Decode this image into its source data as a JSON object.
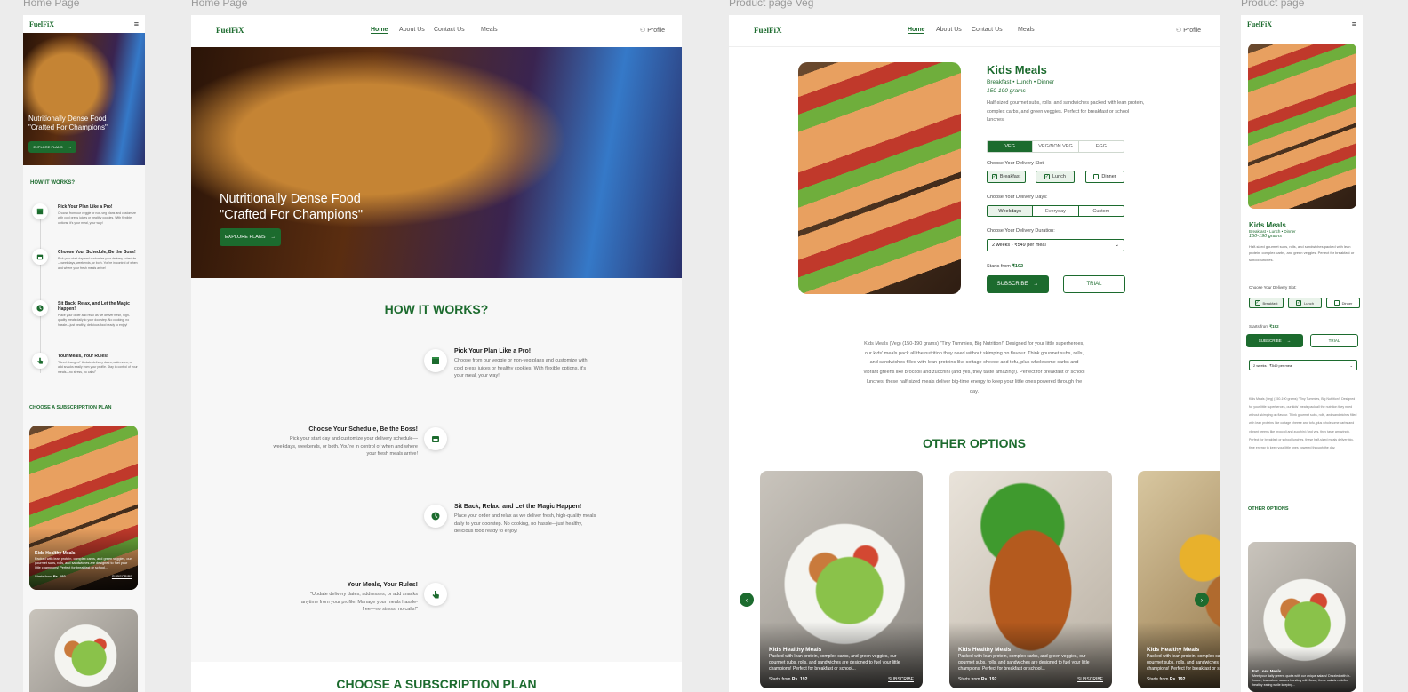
{
  "frames": {
    "home_mobile": "Home Page",
    "home_desktop": "Home Page",
    "product_desktop": "Product page Veg",
    "product_mobile": "Product page"
  },
  "brand": {
    "logo": "FuelFiX",
    "accent": "#1c6b2e"
  },
  "nav": {
    "home": "Home",
    "about": "About Us",
    "contact": "Contact Us",
    "meals": "Meals",
    "profile": "Profile"
  },
  "hero": {
    "line1": "Nutritionally Dense Food",
    "line2": "\"Crafted For Champions\"",
    "cta": "EXPLORE PLANS"
  },
  "how": {
    "title": "HOW IT WORKS?",
    "steps": [
      {
        "title": "Pick Your Plan Like a Pro!",
        "text": "Choose from our veggie or non-veg plans and customize with cold press juices or healthy cookies. With flexible options, it's your meal, your way!",
        "icon": "box-icon"
      },
      {
        "title": "Choose Your Schedule, Be the Boss!",
        "text": "Pick your start day and customize your delivery schedule—weekdays, weekends, or both. You're in control of when and where your fresh meals arrive!",
        "icon": "calendar-icon"
      },
      {
        "title": "Sit Back, Relax, and Let the Magic Happen!",
        "text": "Place your order and relax as we deliver fresh, high-quality meals daily to your doorstep. No cooking, no hassle—just healthy, delicious food ready to enjoy!",
        "icon": "clock-icon"
      },
      {
        "title": "Your Meals, Your Rules!",
        "text": "\"Update delivery dates, addresses, or add snacks anytime from your profile. Manage your meals hassle-free—no stress, no calls!\"",
        "icon": "hand-pointer-icon"
      }
    ],
    "mobile_step1_text": "Choose from our veggie or non-veg plans and customize with cold press juices or healthy cookies. With flexible options, it's your meal, your way!",
    "mobile_step4_text": "\"Need changes? Update delivery dates, addresses, or add snacks easily from your profile. Stay in control of your meals—no stress, no calls!\""
  },
  "subscription": {
    "title": "CHOOSE A SUBSCRIPTION PLAN",
    "mobile_title": "CHOOSE A SUBSCRIPRTION PLAN"
  },
  "card": {
    "title": "Kids Healthy Meals",
    "desc": "Packed with lean protein, complex carbs, and green veggies, our gourmet subs, rolls, and sandwiches are designed to fuel your little champions! Perfect for breakfast or school...",
    "price_label": "Starts from",
    "price": "Rs. 192",
    "cta": "SUBSCRIBE"
  },
  "fat_loss_card": {
    "title": "Fat Loss Meals",
    "desc": "Meet your daily greens quota with our unique salads! Drizzled with in-house, low-calorie sauces bursting with flavor, these salads redefine healthy eating while keeping..."
  },
  "product": {
    "title": "Kids Meals",
    "meals": "Breakfast • Lunch • Dinner",
    "grams": "150-190 grams",
    "desc": "Half-sized gourmet subs, rolls, and sandwiches packed with lean protein, complex carbs, and green veggies. Perfect for breakfast or school lunches.",
    "types": [
      "VEG",
      "VEG/NON VEG",
      "EGG"
    ],
    "slot_label": "Choose Your Delivery Slot:",
    "slots": [
      {
        "label": "Breakfast",
        "checked": true
      },
      {
        "label": "Lunch",
        "checked": true
      },
      {
        "label": "Dinner",
        "checked": false
      }
    ],
    "days_label": "Choose Your Delivery Days:",
    "days": [
      "Weekdays",
      "Everyday",
      "Custom"
    ],
    "duration_label": "Choose Your Delivery Duration:",
    "duration_value": "2 weeks - ₹549 per meal",
    "starts_label": "Starts from",
    "starts_price": "₹192",
    "subscribe": "SUBSCRIBE",
    "trial": "TRIAL",
    "long_desc": "Kids Meals (Veg) (150-190 grams) \"Tiny Tummies, Big Nutrition!\" Designed for your little superheroes, our kids' meals pack all the nutrition they need without skimping on flavour. Think gourmet subs, rolls, and sandwiches filled with lean proteins like cottage cheese and tofu, plus wholesome carbs and vibrant greens like broccoli and zucchini (and yes, they taste amazing!). Perfect for breakfast or school lunches, these half-sized meals deliver big-time energy to keep your little ones powered through the day.",
    "other_title": "OTHER OPTIONS"
  }
}
